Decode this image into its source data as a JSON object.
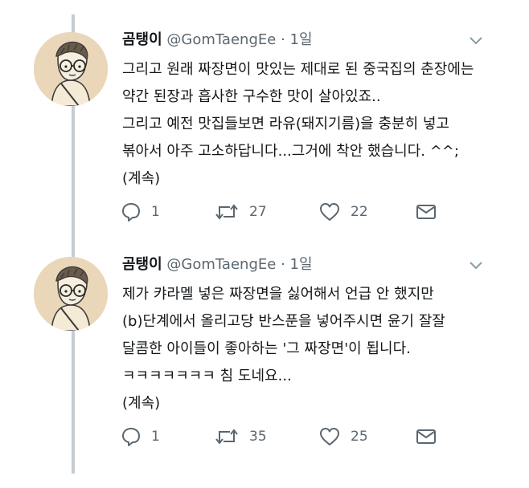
{
  "tweets": [
    {
      "name": "곰탱이",
      "handle": "@GomTaengEe",
      "separator": "·",
      "time": "1일",
      "lines": [
        "그리고 원래 짜장면이 맛있는 제대로 된 중국집의 춘장에는",
        "약간 된장과 흡사한 구수한 맛이 살아있죠..",
        "그리고 예전 맛집들보면 라유(돼지기름)을 충분히 넣고",
        "볶아서 아주 고소하답니다...그거에 착안 했습니다. ^^;",
        "(계속)"
      ],
      "replies": "1",
      "retweets": "27",
      "likes": "22"
    },
    {
      "name": "곰탱이",
      "handle": "@GomTaengEe",
      "separator": "·",
      "time": "1일",
      "lines": [
        "제가 캬라멜 넣은 짜장면을 싫어해서 언급 안 했지만",
        "(b)단계에서 올리고당 반스푼을 넣어주시면 윤기 잘잘",
        "달콤한 아이들이 좋아하는 '그 짜장면'이 됩니다.",
        "ㅋㅋㅋㅋㅋㅋㅋ 침 도네요...",
        "(계속)"
      ],
      "replies": "1",
      "retweets": "35",
      "likes": "25"
    }
  ],
  "icons": {
    "reply": "reply-icon",
    "retweet": "retweet-icon",
    "like": "heart-icon",
    "dm": "envelope-icon",
    "caret": "chevron-down-icon"
  },
  "colors": {
    "text": "#14171a",
    "muted": "#5b6770",
    "thread_line": "#c4cdd3",
    "avatar_bg": "#ead7b9"
  }
}
